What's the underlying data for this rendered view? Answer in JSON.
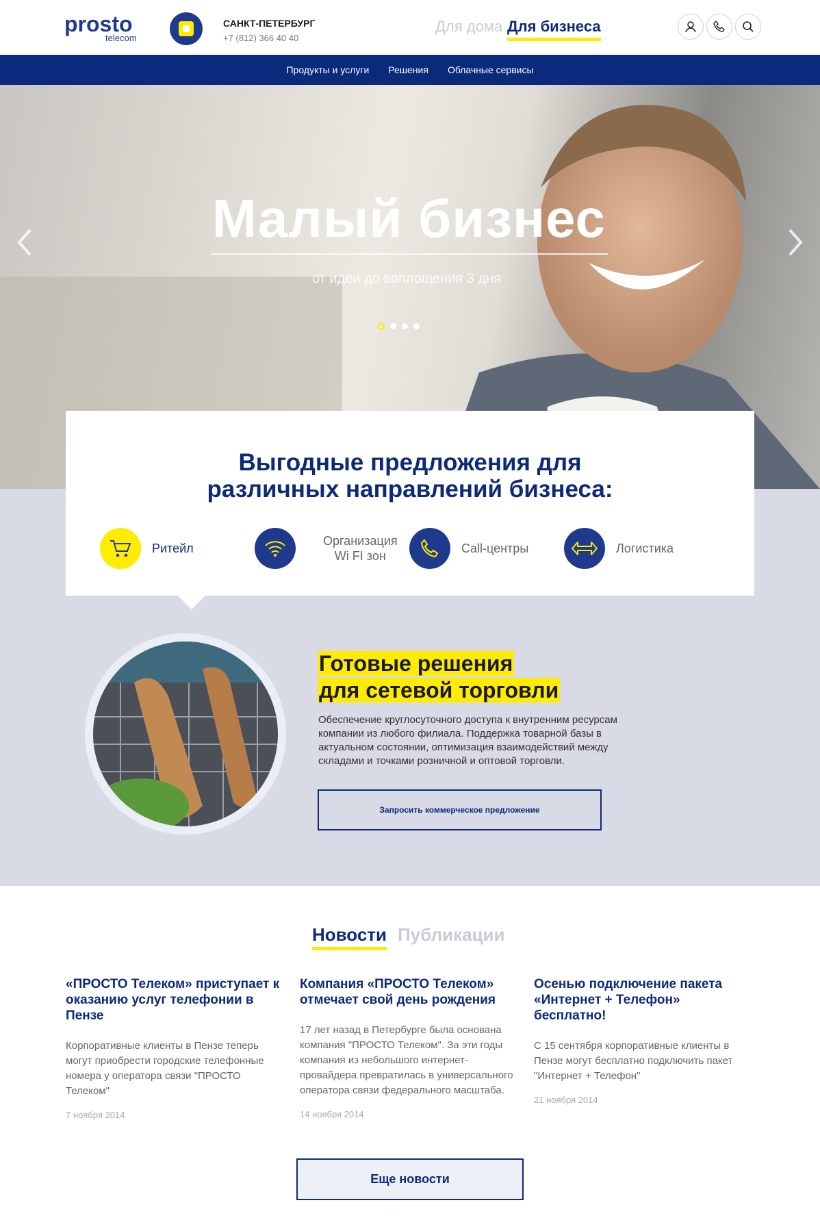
{
  "header": {
    "logo_word": "prosto",
    "logo_sub": "telecom",
    "city": "САНКТ-ПЕТЕРБУРГ",
    "phone": "+7 (812) 366 40 40",
    "seg_home": "Для дома",
    "seg_business": "Для бизнеса",
    "icons": [
      "user-icon",
      "phone-icon",
      "search-icon"
    ]
  },
  "nav": {
    "items": [
      "Продукты и услуги",
      "Решения",
      "Облачные сервисы"
    ]
  },
  "hero": {
    "title": "Малый бизнес",
    "subtitle": "от идеи до воплощения 3 дня",
    "slides": 4,
    "active_slide": 1
  },
  "offers": {
    "title_1": "Выгодные предложения для",
    "title_2": "различных направлений бизнеса:",
    "categories": [
      {
        "label": "Ритейл",
        "icon": "cart-icon"
      },
      {
        "label_1": "Организация",
        "label_2": "Wi FI зон",
        "icon": "wifi-icon"
      },
      {
        "label": "Call-центры",
        "icon": "phone-icon"
      },
      {
        "label": "Логистика",
        "icon": "double-arrow-icon"
      }
    ]
  },
  "solution": {
    "title_1": "Готовые решения",
    "title_2": "для сетевой торговли",
    "description": "Обеспечение круглосуточного доступа к внутренним ресурсам компании из любого филиала. Поддержка товарной базы в актуальном состоянии, оптимизация взаимодействий между складами и точками розничной и оптовой торговли.",
    "button": "Запросить коммерческое предложение"
  },
  "news": {
    "tab_news": "Новости",
    "tab_pubs": "Публикации",
    "items": [
      {
        "title": "«ПРОСТО Телеком» приступает к оказанию услуг телефонии в Пензе",
        "text": "Корпоративные клиенты в Пензе теперь могут приобрести городские телефонные номера у оператора связи \"ПРОСТО Телеком\"",
        "date": "7 ноября 2014"
      },
      {
        "title": "Компания «ПРОСТО Телеком» отмечает свой день рождения",
        "text": "17 лет назад в Петербурге была основана компания \"ПРОСТО Телеком\". За эти годы компания  из небольшого интернет-провайдера превратилась в универсального оператора связи федерального масштаба.",
        "date": "14 ноября 2014"
      },
      {
        "title": "Осенью подключение пакета «Интернет + Телефон» бесплатно!",
        "text": "С 15 сентября корпоративные клиенты в Пензе могут бесплатно подключить пакет \"Интернет + Телефон\"",
        "date": "21 ноября 2014"
      }
    ],
    "more_button": "Еще новости"
  },
  "colors": {
    "brand": "#0b2a7c",
    "accent": "#ffec00",
    "section_bg": "#d8dae6"
  }
}
